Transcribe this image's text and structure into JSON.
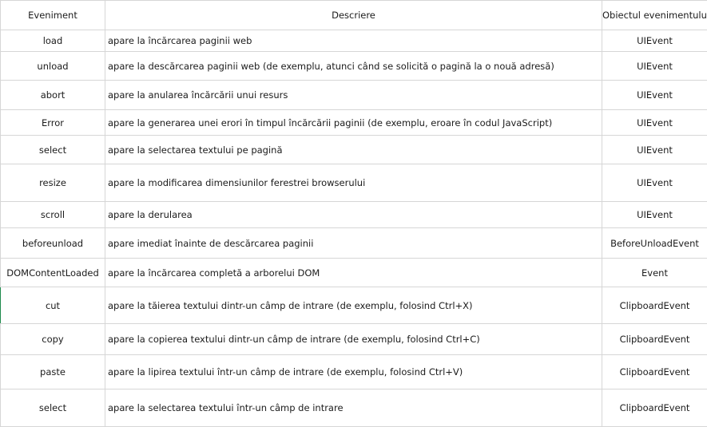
{
  "table": {
    "headers": {
      "event": "Eveniment",
      "description": "Descriere",
      "object": "Obiectul evenimentului"
    },
    "rows": [
      {
        "event": "load",
        "description": "apare la încărcarea paginii web",
        "object": "UIEvent"
      },
      {
        "event": "unload",
        "description": "apare la descărcarea paginii web (de exemplu, atunci când se solicită o pagină la o nouă adresă)",
        "object": "UIEvent"
      },
      {
        "event": "abort",
        "description": "apare la anularea încărcării unui resurs",
        "object": "UIEvent"
      },
      {
        "event": "Error",
        "description": "apare la generarea unei erori în timpul încărcării paginii (de exemplu, eroare în codul JavaScript)",
        "object": "UIEvent"
      },
      {
        "event": "select",
        "description": "apare la selectarea textului pe pagină",
        "object": "UIEvent"
      },
      {
        "event": "resize",
        "description": "apare la modificarea dimensiunilor ferestrei browserului",
        "object": "UIEvent"
      },
      {
        "event": "scroll",
        "description": "apare la derularea",
        "object": "UIEvent"
      },
      {
        "event": "beforeunload",
        "description": "apare imediat înainte de descărcarea paginii",
        "object": "BeforeUnloadEvent"
      },
      {
        "event": "DOMContentLoaded",
        "description": "apare la încărcarea completă a arborelui DOM",
        "object": "Event"
      },
      {
        "event": "cut",
        "description": "apare la tăierea textului dintr-un câmp de intrare (de exemplu, folosind Ctrl+X)",
        "object": "ClipboardEvent"
      },
      {
        "event": "copy",
        "description": "apare la copierea textului dintr-un câmp de intrare (de exemplu, folosind Ctrl+C)",
        "object": "ClipboardEvent"
      },
      {
        "event": "paste",
        "description": "apare la lipirea textului într-un câmp de intrare (de exemplu, folosind Ctrl+V)",
        "object": "ClipboardEvent"
      },
      {
        "event": "select",
        "description": "apare la selectarea textului într-un câmp de intrare",
        "object": "ClipboardEvent"
      }
    ]
  }
}
